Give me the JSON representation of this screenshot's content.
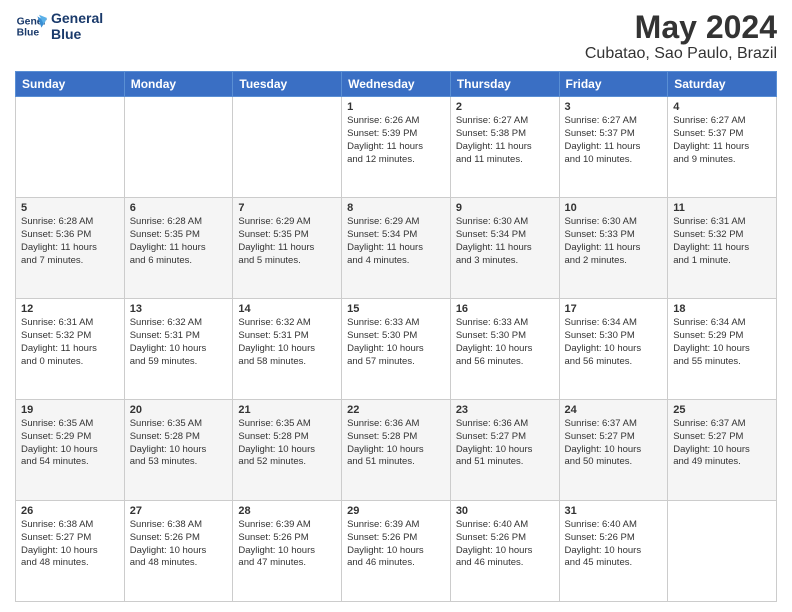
{
  "header": {
    "logo_line1": "General",
    "logo_line2": "Blue",
    "month": "May 2024",
    "location": "Cubatao, Sao Paulo, Brazil"
  },
  "weekdays": [
    "Sunday",
    "Monday",
    "Tuesday",
    "Wednesday",
    "Thursday",
    "Friday",
    "Saturday"
  ],
  "weeks": [
    [
      {
        "day": "",
        "info": ""
      },
      {
        "day": "",
        "info": ""
      },
      {
        "day": "",
        "info": ""
      },
      {
        "day": "1",
        "info": "Sunrise: 6:26 AM\nSunset: 5:39 PM\nDaylight: 11 hours\nand 12 minutes."
      },
      {
        "day": "2",
        "info": "Sunrise: 6:27 AM\nSunset: 5:38 PM\nDaylight: 11 hours\nand 11 minutes."
      },
      {
        "day": "3",
        "info": "Sunrise: 6:27 AM\nSunset: 5:37 PM\nDaylight: 11 hours\nand 10 minutes."
      },
      {
        "day": "4",
        "info": "Sunrise: 6:27 AM\nSunset: 5:37 PM\nDaylight: 11 hours\nand 9 minutes."
      }
    ],
    [
      {
        "day": "5",
        "info": "Sunrise: 6:28 AM\nSunset: 5:36 PM\nDaylight: 11 hours\nand 7 minutes."
      },
      {
        "day": "6",
        "info": "Sunrise: 6:28 AM\nSunset: 5:35 PM\nDaylight: 11 hours\nand 6 minutes."
      },
      {
        "day": "7",
        "info": "Sunrise: 6:29 AM\nSunset: 5:35 PM\nDaylight: 11 hours\nand 5 minutes."
      },
      {
        "day": "8",
        "info": "Sunrise: 6:29 AM\nSunset: 5:34 PM\nDaylight: 11 hours\nand 4 minutes."
      },
      {
        "day": "9",
        "info": "Sunrise: 6:30 AM\nSunset: 5:34 PM\nDaylight: 11 hours\nand 3 minutes."
      },
      {
        "day": "10",
        "info": "Sunrise: 6:30 AM\nSunset: 5:33 PM\nDaylight: 11 hours\nand 2 minutes."
      },
      {
        "day": "11",
        "info": "Sunrise: 6:31 AM\nSunset: 5:32 PM\nDaylight: 11 hours\nand 1 minute."
      }
    ],
    [
      {
        "day": "12",
        "info": "Sunrise: 6:31 AM\nSunset: 5:32 PM\nDaylight: 11 hours\nand 0 minutes."
      },
      {
        "day": "13",
        "info": "Sunrise: 6:32 AM\nSunset: 5:31 PM\nDaylight: 10 hours\nand 59 minutes."
      },
      {
        "day": "14",
        "info": "Sunrise: 6:32 AM\nSunset: 5:31 PM\nDaylight: 10 hours\nand 58 minutes."
      },
      {
        "day": "15",
        "info": "Sunrise: 6:33 AM\nSunset: 5:30 PM\nDaylight: 10 hours\nand 57 minutes."
      },
      {
        "day": "16",
        "info": "Sunrise: 6:33 AM\nSunset: 5:30 PM\nDaylight: 10 hours\nand 56 minutes."
      },
      {
        "day": "17",
        "info": "Sunrise: 6:34 AM\nSunset: 5:30 PM\nDaylight: 10 hours\nand 56 minutes."
      },
      {
        "day": "18",
        "info": "Sunrise: 6:34 AM\nSunset: 5:29 PM\nDaylight: 10 hours\nand 55 minutes."
      }
    ],
    [
      {
        "day": "19",
        "info": "Sunrise: 6:35 AM\nSunset: 5:29 PM\nDaylight: 10 hours\nand 54 minutes."
      },
      {
        "day": "20",
        "info": "Sunrise: 6:35 AM\nSunset: 5:28 PM\nDaylight: 10 hours\nand 53 minutes."
      },
      {
        "day": "21",
        "info": "Sunrise: 6:35 AM\nSunset: 5:28 PM\nDaylight: 10 hours\nand 52 minutes."
      },
      {
        "day": "22",
        "info": "Sunrise: 6:36 AM\nSunset: 5:28 PM\nDaylight: 10 hours\nand 51 minutes."
      },
      {
        "day": "23",
        "info": "Sunrise: 6:36 AM\nSunset: 5:27 PM\nDaylight: 10 hours\nand 51 minutes."
      },
      {
        "day": "24",
        "info": "Sunrise: 6:37 AM\nSunset: 5:27 PM\nDaylight: 10 hours\nand 50 minutes."
      },
      {
        "day": "25",
        "info": "Sunrise: 6:37 AM\nSunset: 5:27 PM\nDaylight: 10 hours\nand 49 minutes."
      }
    ],
    [
      {
        "day": "26",
        "info": "Sunrise: 6:38 AM\nSunset: 5:27 PM\nDaylight: 10 hours\nand 48 minutes."
      },
      {
        "day": "27",
        "info": "Sunrise: 6:38 AM\nSunset: 5:26 PM\nDaylight: 10 hours\nand 48 minutes."
      },
      {
        "day": "28",
        "info": "Sunrise: 6:39 AM\nSunset: 5:26 PM\nDaylight: 10 hours\nand 47 minutes."
      },
      {
        "day": "29",
        "info": "Sunrise: 6:39 AM\nSunset: 5:26 PM\nDaylight: 10 hours\nand 46 minutes."
      },
      {
        "day": "30",
        "info": "Sunrise: 6:40 AM\nSunset: 5:26 PM\nDaylight: 10 hours\nand 46 minutes."
      },
      {
        "day": "31",
        "info": "Sunrise: 6:40 AM\nSunset: 5:26 PM\nDaylight: 10 hours\nand 45 minutes."
      },
      {
        "day": "",
        "info": ""
      }
    ]
  ]
}
